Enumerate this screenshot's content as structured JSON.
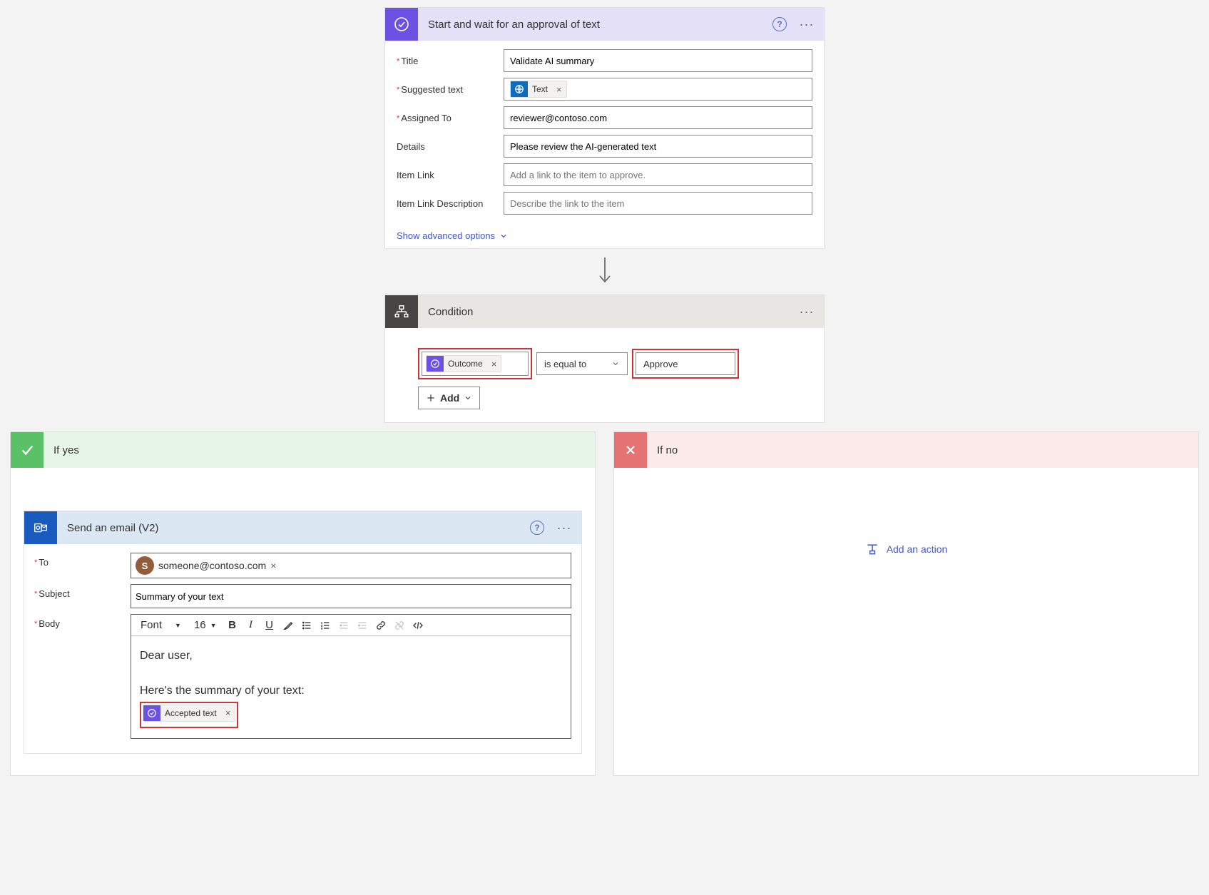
{
  "approval": {
    "title": "Start and wait for an approval of text",
    "fields": {
      "title_label": "Title",
      "title_value": "Validate AI summary",
      "suggested_label": "Suggested text",
      "suggested_token": "Text",
      "assigned_label": "Assigned To",
      "assigned_value": "reviewer@contoso.com",
      "details_label": "Details",
      "details_value": "Please review the AI-generated text",
      "itemlink_label": "Item Link",
      "itemlink_placeholder": "Add a link to the item to approve.",
      "itemlinkdesc_label": "Item Link Description",
      "itemlinkdesc_placeholder": "Describe the link to the item"
    },
    "advanced_link": "Show advanced options"
  },
  "condition": {
    "title": "Condition",
    "left_token": "Outcome",
    "operator": "is equal to",
    "right_value": "Approve",
    "add_label": "Add"
  },
  "branches": {
    "yes_title": "If yes",
    "no_title": "If no",
    "add_action_label": "Add an action"
  },
  "email": {
    "title": "Send an email (V2)",
    "to_label": "To",
    "to_initial": "S",
    "to_value": "someone@contoso.com",
    "subject_label": "Subject",
    "subject_value": "Summary of your text",
    "body_label": "Body",
    "font_label": "Font",
    "font_size": "16",
    "body_line1": "Dear user,",
    "body_line2": "Here's the summary of your text:",
    "accepted_token": "Accepted text"
  }
}
